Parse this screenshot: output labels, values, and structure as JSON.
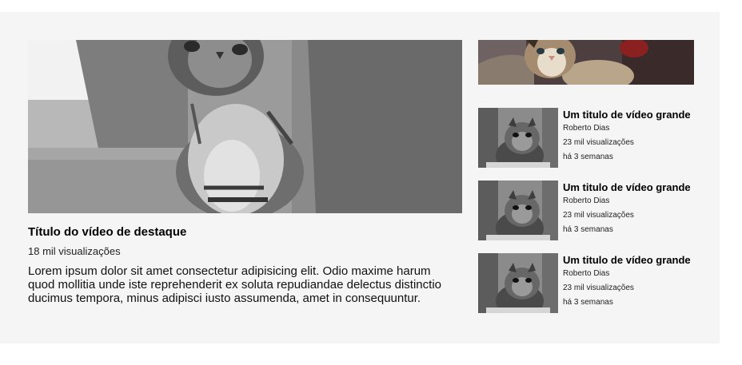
{
  "featured": {
    "thumbnail_alt": "cat",
    "title": "Título do vídeo de destaque",
    "views": "18 mil visualizações",
    "description": "Lorem ipsum dolor sit amet consectetur adipisicing elit. Odio maxime harum quod mollitia unde iste reprehenderit ex soluta repudiandae delectus distinctio ducimus tempora, minus adipisci iusto assumenda, amet in consequuntur."
  },
  "sidebar": {
    "top_thumbnail_alt": "cat",
    "videos": [
      {
        "title": "Um titulo de vídeo grande",
        "channel": "Roberto Dias",
        "views": "23 mil visualizações",
        "age": "há 3 semanas"
      },
      {
        "title": "Um titulo de vídeo grande",
        "channel": "Roberto Dias",
        "views": "23 mil visualizações",
        "age": "há 3 semanas"
      },
      {
        "title": "Um titulo de vídeo grande",
        "channel": "Roberto Dias",
        "views": "23 mil visualizações",
        "age": "há 3 semanas"
      }
    ]
  }
}
